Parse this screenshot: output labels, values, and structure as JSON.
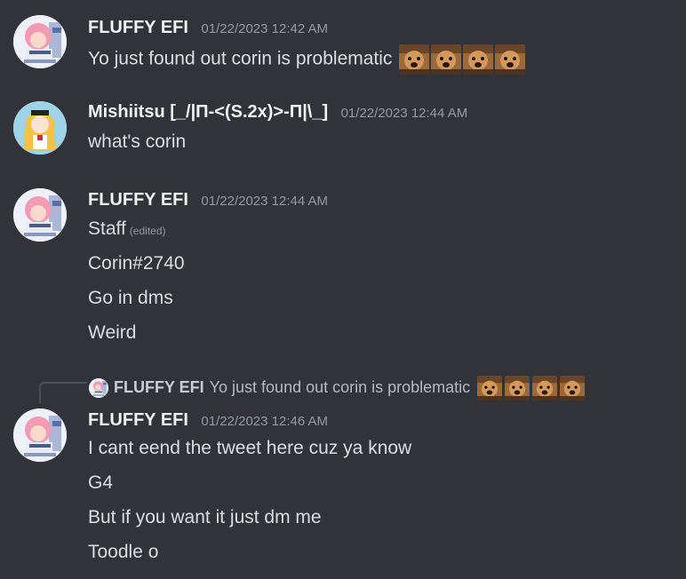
{
  "messages": [
    {
      "username": "FLUFFY EFI",
      "timestamp": "01/22/2023 12:42 AM",
      "lines": [
        "Yo just found out corin is problematic"
      ],
      "emoji_count": 4
    },
    {
      "username": "Mishiitsu [_/|Π-<(S.2x)>-Π|\\_]",
      "timestamp": "01/22/2023 12:44 AM",
      "lines": [
        "what's corin"
      ]
    },
    {
      "username": "FLUFFY EFI",
      "timestamp": "01/22/2023 12:44 AM",
      "lines": [
        "Staff",
        "Corin#2740",
        "Go in dms",
        "Weird"
      ],
      "edited_label": "(edited)"
    },
    {
      "reply": {
        "username": "FLUFFY EFI",
        "text": "Yo just found out corin is problematic",
        "emoji_count": 4
      },
      "username": "FLUFFY EFI",
      "timestamp": "01/22/2023 12:46 AM",
      "lines": [
        "I cant eend the tweet here cuz ya know",
        "G4",
        "But if you want it just dm me",
        "Toodle o"
      ]
    }
  ],
  "icons": {
    "avatar_fluffy": "anime-avatar-pink-hair",
    "avatar_mishiitsu": "anime-avatar-blonde-hair",
    "emoji": "doge-face-emoji"
  },
  "colors": {
    "background": "#313338",
    "username": "#f2f3f5",
    "timestamp": "#949ba4",
    "text": "#dbdee1"
  }
}
